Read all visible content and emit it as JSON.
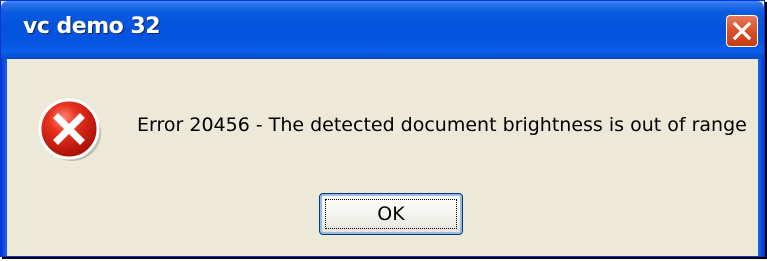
{
  "window": {
    "title": "vc demo 32",
    "close_icon": "close-icon"
  },
  "dialog": {
    "icon": "error-icon",
    "message": "Error 20456 - The detected document brightness is out of range",
    "ok_label": "OK"
  },
  "colors": {
    "titlebar": "#0453dc",
    "body": "#ece9d8",
    "close_button": "#d8532c",
    "error_red": "#d40000"
  }
}
